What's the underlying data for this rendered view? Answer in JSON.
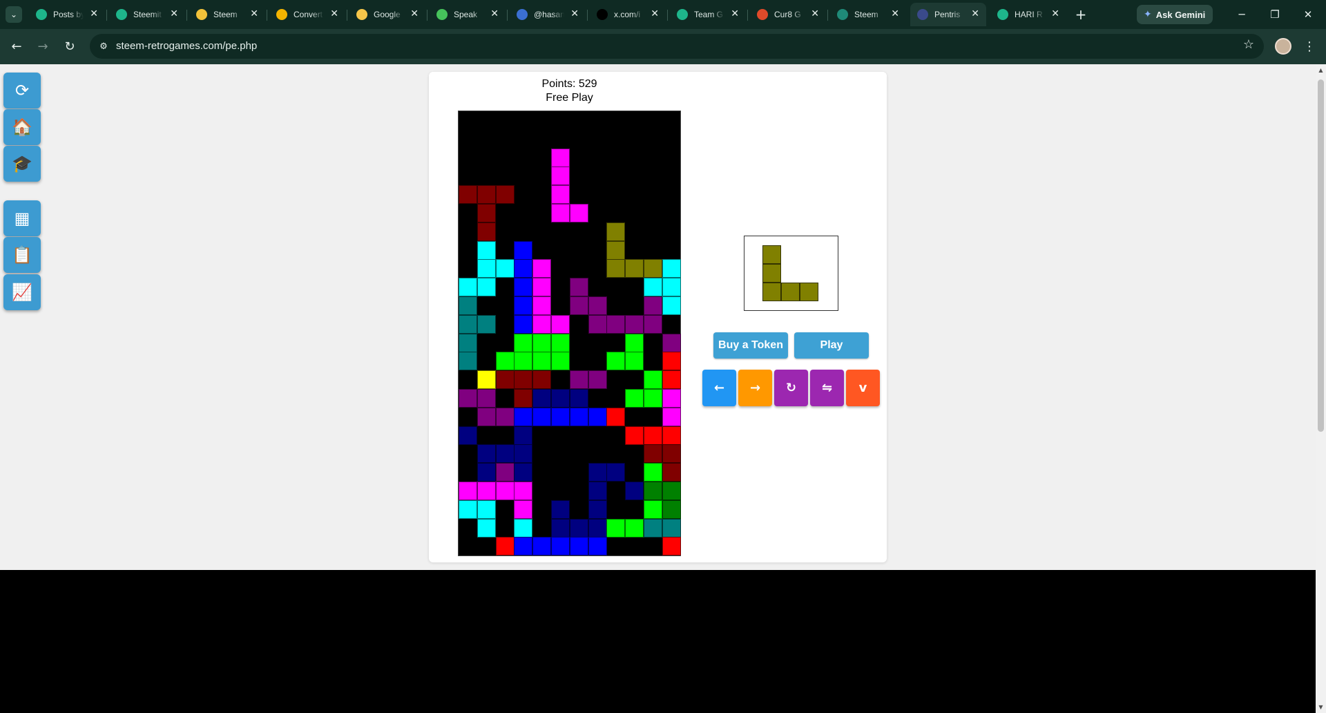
{
  "browser": {
    "tabs": [
      {
        "title": "Posts by",
        "icon": "steemit-icon",
        "color": "#1eb58b"
      },
      {
        "title": "Steemit",
        "icon": "steemit-icon",
        "color": "#1eb58b"
      },
      {
        "title": "Steem",
        "icon": "emoji-icon",
        "color": "#f2c23a"
      },
      {
        "title": "Convert",
        "icon": "google-drive-icon",
        "color": "#f4b400"
      },
      {
        "title": "Google",
        "icon": "lightbulb-icon",
        "color": "#f6c64a"
      },
      {
        "title": "Speak",
        "icon": "play-icon",
        "color": "#46c25b"
      },
      {
        "title": "@hasan",
        "icon": "globe-icon",
        "color": "#3b6fd1"
      },
      {
        "title": "x.com/i",
        "icon": "x-icon",
        "color": "#000000"
      },
      {
        "title": "Team G",
        "icon": "steemit-icon",
        "color": "#1eb58b"
      },
      {
        "title": "Cur8 G",
        "icon": "cur8-icon",
        "color": "#e04a2a"
      },
      {
        "title": "Steem",
        "icon": "steem-icon",
        "color": "#1f8a78"
      },
      {
        "title": "Pentris",
        "icon": "pentris-icon",
        "color": "#3a4a8a",
        "active": true
      },
      {
        "title": "HARI R",
        "icon": "b4-icon",
        "color": "#1eb58b"
      }
    ],
    "gemini_label": "Ask Gemini",
    "url": "steem-retrogames.com/pe.php"
  },
  "sidebar": [
    {
      "name": "reload-icon",
      "glyph": "⟳"
    },
    {
      "name": "home-icon",
      "glyph": "🏠"
    },
    {
      "name": "graduation-cap-icon",
      "glyph": "🎓"
    },
    {
      "name": "grid-icon",
      "glyph": "▦"
    },
    {
      "name": "clipboard-icon",
      "glyph": "📋"
    },
    {
      "name": "chart-icon",
      "glyph": "📈"
    }
  ],
  "game": {
    "points_text": "Points: 529",
    "mode_text": "Free Play",
    "buy_token_label": "Buy a Token",
    "play_label": "Play",
    "controls": [
      {
        "name": "move-left-button",
        "glyph": "←",
        "color": "#2196f3"
      },
      {
        "name": "move-right-button",
        "glyph": "→",
        "color": "#ff9800"
      },
      {
        "name": "rotate-button",
        "glyph": "↻",
        "color": "#9c27b0"
      },
      {
        "name": "flip-button",
        "glyph": "⇋",
        "color": "#9c27b0"
      },
      {
        "name": "drop-button",
        "glyph": "v",
        "color": "#ff5722"
      }
    ],
    "colors": {
      "R": "#800000",
      "M": "#ff00ff",
      "O": "#808000",
      "C": "#00ffff",
      "B": "#0000ff",
      "T": "#008080",
      "P": "#800080",
      "G": "#00ff00",
      "Y": "#ffff00",
      "D": "#000080",
      "E": "#ff0000",
      "N": "#008000"
    },
    "board_grid": [
      "............",
      "............",
      ".....M......",
      ".....M......",
      "RRR..M......",
      ".R...MM.....",
      ".R......O...",
      ".C.B....O...",
      ".CCBM...OOOCC",
      "CC.BM.P...CC",
      "T..BM.PP..PC.",
      "TT.BMM.PPPP.",
      "T..GGG...G.PP",
      "T.GGGG..GG.E",
      ".YRRR.PP..GE",
      "PP.RDDD..GGM",
      ".PPBBBBBE..M",
      "D..D.....EEEMM",
      ".DDD......RRR",
      ".DPD...DD.GR",
      "MMMM...D.DNN",
      "CC.M.D.D..GNT",
      ".C.C.DDDGGTT",
      "..EBBBBB...E."
    ],
    "next_piece": {
      "color": "#808000",
      "cells": [
        [
          0,
          0
        ],
        [
          0,
          1
        ],
        [
          0,
          2
        ],
        [
          1,
          2
        ],
        [
          2,
          2
        ]
      ]
    }
  }
}
